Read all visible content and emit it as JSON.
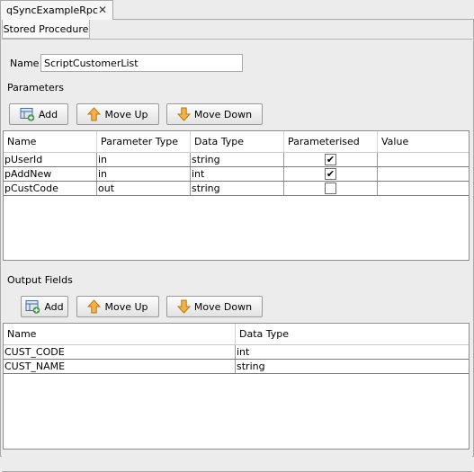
{
  "tab": {
    "title": "qSyncExampleRpc",
    "close_glyph": "✕"
  },
  "subtab": {
    "label": "Stored Procedure"
  },
  "name_field": {
    "label": "Name",
    "value": "ScriptCustomerList"
  },
  "parameters": {
    "section_label": "Parameters",
    "buttons": {
      "add": "Add",
      "move_up": "Move Up",
      "move_down": "Move Down"
    },
    "columns": [
      "Name",
      "Parameter Type",
      "Data Type",
      "Parameterised",
      "Value"
    ],
    "rows": [
      {
        "name": "pUserId",
        "param_type": "in",
        "data_type": "string",
        "parameterised": true,
        "value": ""
      },
      {
        "name": "pAddNew",
        "param_type": "in",
        "data_type": "int",
        "parameterised": true,
        "value": ""
      },
      {
        "name": "pCustCode",
        "param_type": "out",
        "data_type": "string",
        "parameterised": false,
        "value": ""
      }
    ]
  },
  "output_fields": {
    "section_label": "Output Fields",
    "buttons": {
      "add": "Add",
      "move_up": "Move Up",
      "move_down": "Move Down"
    },
    "columns": [
      "Name",
      "Data Type"
    ],
    "rows": [
      {
        "name": "CUST_CODE",
        "data_type": "int"
      },
      {
        "name": "CUST_NAME",
        "data_type": "string"
      }
    ]
  },
  "icons": {
    "add": "add-table-icon",
    "up": "arrow-up-icon",
    "down": "arrow-down-icon",
    "check": "✔"
  }
}
